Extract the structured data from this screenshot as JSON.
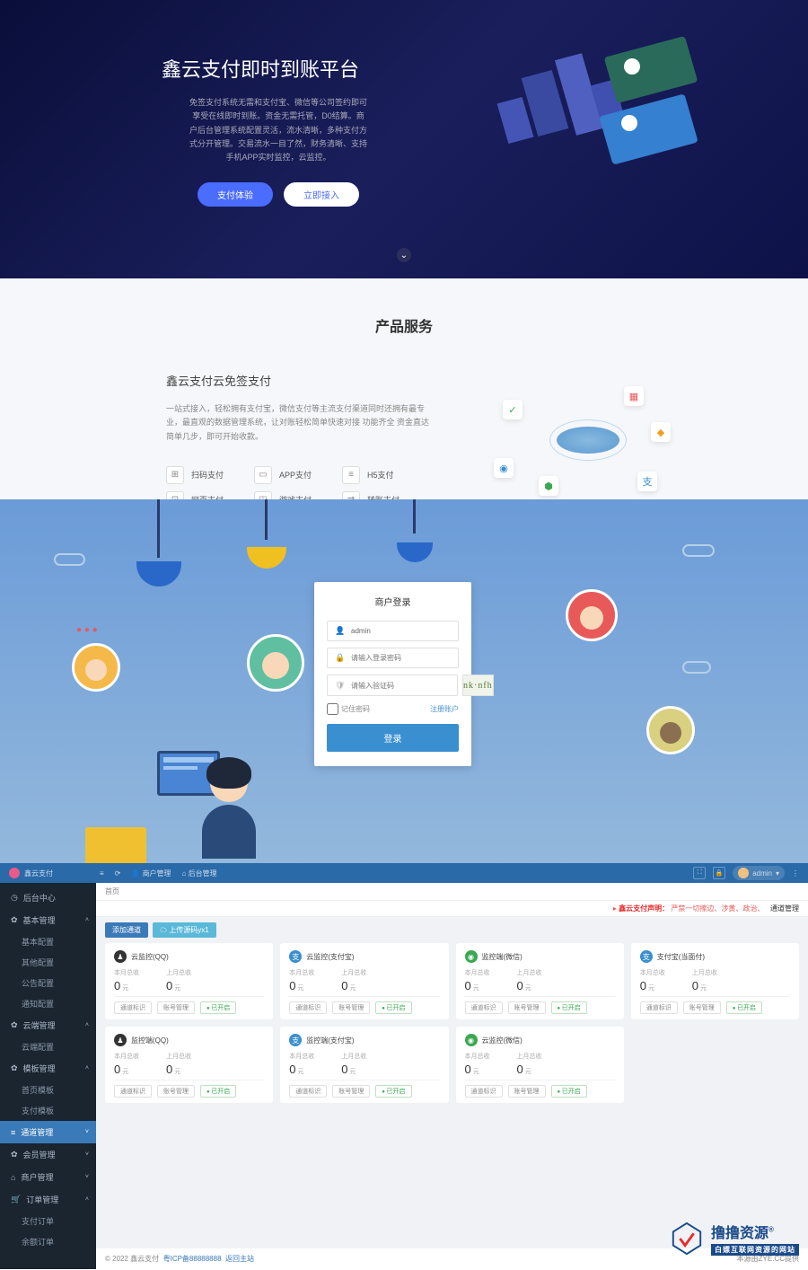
{
  "hero": {
    "title": "鑫云支付即时到账平台",
    "desc": "免签支付系统无需和支付宝、微信等公司签约即可享受在线即时到账。资金无需托管，D0结算。商户后台管理系统配置灵活，流水清晰，多种支付方式分开管理。交易流水一目了然，财务清晰、支持手机APP实时监控，云监控。",
    "btn_try": "支付体验",
    "btn_join": "立即接入"
  },
  "products": {
    "section_title": "产品服务",
    "heading": "鑫云支付云免签支付",
    "desc": "一站式接入，轻松拥有支付宝，微信支付等主流支付渠道同时还拥有最专业，最直观的数据管理系统，让对账轻松简单快速对接 功能齐全 资金直达简单几步，即可开始收款。",
    "items": [
      {
        "icon": "⊞",
        "label": "扫码支付"
      },
      {
        "icon": "▭",
        "label": "APP支付"
      },
      {
        "icon": "≡",
        "label": "H5支付"
      },
      {
        "icon": "⊡",
        "label": "网页支付"
      },
      {
        "icon": "◫",
        "label": "游戏支付"
      },
      {
        "icon": "⇄",
        "label": "转账支付"
      }
    ]
  },
  "login": {
    "title": "商户登录",
    "username_value": "admin",
    "password_ph": "请输入登录密码",
    "captcha_ph": "请输入验证码",
    "captcha_text": "nk·nfh",
    "remember": "记住密码",
    "register": "注册账户",
    "submit": "登录"
  },
  "admin": {
    "brand": "鑫云支付",
    "toolbar": {
      "merchant": "商户管理",
      "backend": "后台管理"
    },
    "user": "admin",
    "breadcrumb": "首页",
    "notice_label": "鑫云支付声明：",
    "notice_text": "严禁一切擦边、涉黄、政治、",
    "notice_link": "通道管理",
    "actions": {
      "add": "添加通道",
      "return": "上传源码yx1"
    },
    "sidebar": {
      "back": "后台中心",
      "groups": [
        {
          "icon": "✿",
          "label": "基本管理",
          "open": true,
          "subs": [
            "基本配置",
            "其他配置",
            "公告配置",
            "通知配置"
          ]
        },
        {
          "icon": "✿",
          "label": "云端管理",
          "open": true,
          "subs": [
            "云端配置"
          ]
        },
        {
          "icon": "✿",
          "label": "模板管理",
          "open": true,
          "subs": [
            "首页模板",
            "支付模板"
          ]
        },
        {
          "icon": "≡",
          "label": "通道管理",
          "open": false,
          "sel": true,
          "subs": []
        },
        {
          "icon": "✿",
          "label": "会员管理",
          "open": false,
          "subs": []
        },
        {
          "icon": "⌂",
          "label": "商户管理",
          "open": false,
          "subs": []
        },
        {
          "icon": "🛒",
          "label": "订单管理",
          "open": true,
          "subs": [
            "支付订单",
            "余额订单"
          ]
        }
      ]
    },
    "stat_labels": {
      "month": "本月总收",
      "last": "上月总收",
      "unit": "元"
    },
    "card_actions": {
      "mark": "通道标识",
      "acct": "账号管理",
      "on": "已开启"
    },
    "cards": [
      {
        "icon": "qq",
        "title": "云监控(QQ)",
        "m": "0",
        "l": "0"
      },
      {
        "icon": "ali",
        "title": "云监控(支付宝)",
        "m": "0",
        "l": "0"
      },
      {
        "icon": "wx",
        "title": "监控端(微信)",
        "m": "0",
        "l": "0"
      },
      {
        "icon": "ali",
        "title": "支付宝(当面付)",
        "m": "0",
        "l": "0"
      },
      {
        "icon": "qq",
        "title": "监控端(QQ)",
        "m": "0",
        "l": "0"
      },
      {
        "icon": "ali",
        "title": "监控端(支付宝)",
        "m": "0",
        "l": "0"
      },
      {
        "icon": "wx",
        "title": "云监控(微信)",
        "m": "0",
        "l": "0"
      }
    ],
    "footer": {
      "copyright": "© 2022 鑫云支付",
      "icp": "粤ICP备88888888",
      "home": "返回主站",
      "right": "本源由ZYE.CC提供"
    }
  },
  "watermark": {
    "name": "撸撸资源",
    "tag": "白嫖互联网资源的网站",
    "r": "®"
  }
}
